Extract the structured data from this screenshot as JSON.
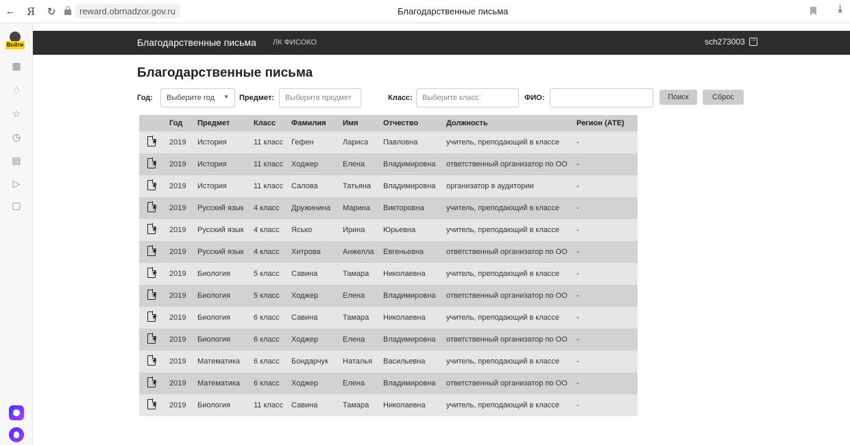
{
  "browser": {
    "url": "reward.obrnadzor.gov.ru",
    "tab_title": "Благодарственные письма",
    "ya_label": "Я"
  },
  "sidebar": {
    "login_label": "Войти"
  },
  "header": {
    "brand": "Благодарственные письма",
    "link": "ЛК ФИСОКО",
    "user": "sch273003"
  },
  "page": {
    "title": "Благодарственные письма"
  },
  "filters": {
    "year_label": "Год:",
    "year_value": "Выберите год",
    "subject_label": "Предмет:",
    "subject_placeholder": "Выберите предмет",
    "class_label": "Класс:",
    "class_placeholder": "Выберите класс",
    "fio_label": "ФИО:",
    "fio_value": "",
    "search_button": "Поиск",
    "reset_button": "Сброс"
  },
  "table": {
    "headers": [
      "",
      "Год",
      "Предмет",
      "Класс",
      "Фамилия",
      "Имя",
      "Отчество",
      "Должность",
      "Регион (АТЕ)"
    ],
    "rows": [
      [
        "2019",
        "История",
        "11 класс",
        "Гефен",
        "Лариса",
        "Павловна",
        "учитель, преподающий в классе",
        "-"
      ],
      [
        "2019",
        "История",
        "11 класс",
        "Ходжер",
        "Елена",
        "Владимировна",
        "ответственный организатор по ОО",
        "-"
      ],
      [
        "2019",
        "История",
        "11 класс",
        "Салова",
        "Татьяна",
        "Владимировна",
        "организатор в аудитории",
        "-"
      ],
      [
        "2019",
        "Русский язык",
        "4 класс",
        "Дружинина",
        "Марина",
        "Викторовна",
        "учитель, преподающий в классе",
        "-"
      ],
      [
        "2019",
        "Русский язык",
        "4 класс",
        "Ясько",
        "Ирина",
        "Юрьевна",
        "учитель, преподающий в классе",
        "-"
      ],
      [
        "2019",
        "Русский язык",
        "4 класс",
        "Хитрова",
        "Анжелла",
        "Евгеньевна",
        "ответственный организатор по ОО",
        "-"
      ],
      [
        "2019",
        "Биология",
        "5 класс",
        "Савина",
        "Тамара",
        "Николаевна",
        "учитель, преподающий в классе",
        "-"
      ],
      [
        "2019",
        "Биология",
        "5 класс",
        "Ходжер",
        "Елена",
        "Владимировна",
        "ответственный организатор по ОО",
        "-"
      ],
      [
        "2019",
        "Биология",
        "6 класс",
        "Савина",
        "Тамара",
        "Николаевна",
        "учитель, преподающий в классе",
        "-"
      ],
      [
        "2019",
        "Биология",
        "6 класс",
        "Ходжер",
        "Елена",
        "Владимировна",
        "ответственный организатор по ОО",
        "-"
      ],
      [
        "2019",
        "Математика",
        "6 класс",
        "Бондарчук",
        "Наталья",
        "Васильевна",
        "учитель, преподающий в классе",
        "-"
      ],
      [
        "2019",
        "Математика",
        "6 класс",
        "Ходжер",
        "Елена",
        "Владимировна",
        "ответственный организатор по ОО",
        "-"
      ],
      [
        "2019",
        "Биология",
        "11 класс",
        "Савина",
        "Тамара",
        "Николаевна",
        "учитель, преподающий в классе",
        "-"
      ]
    ]
  }
}
